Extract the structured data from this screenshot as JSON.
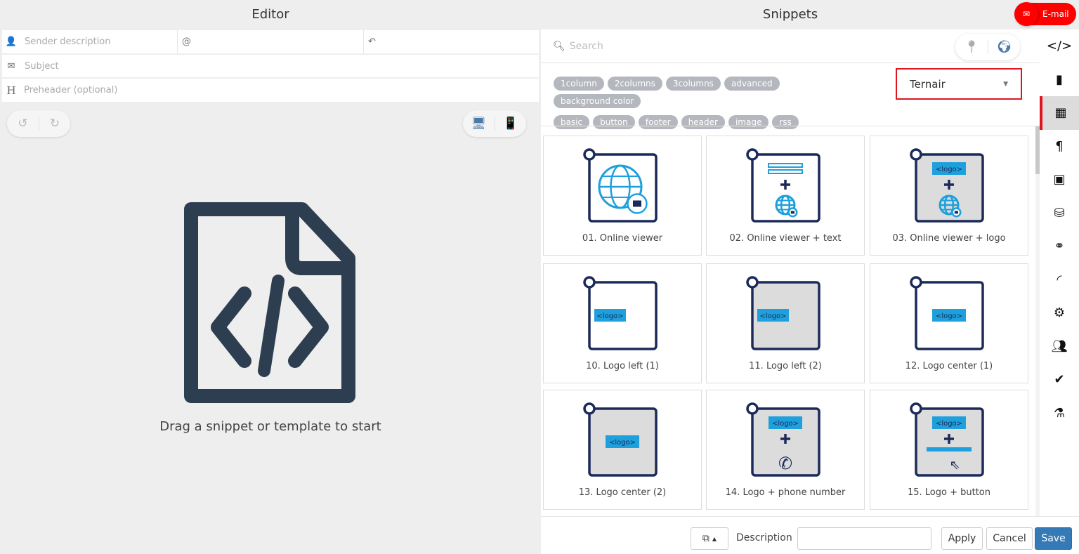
{
  "editor": {
    "title": "Editor",
    "sender_placeholder": "Sender description",
    "email_at": "@",
    "subject_placeholder": "Subject",
    "preheader_icon": "H",
    "preheader_placeholder": "Preheader (optional)",
    "empty_message": "Drag a snippet or template to start"
  },
  "snippets": {
    "title": "Snippets",
    "search_placeholder": "Search",
    "tags": [
      "1column",
      "2columns",
      "3columns",
      "advanced",
      "background color",
      "basic",
      "button",
      "footer",
      "header",
      "image",
      "rss"
    ],
    "select_value": "Ternair",
    "cards": [
      {
        "label": "01. Online viewer",
        "variant": "globe",
        "gray": false
      },
      {
        "label": "02. Online viewer + text",
        "variant": "text-globe",
        "gray": false
      },
      {
        "label": "03. Online viewer + logo",
        "variant": "logo-globe",
        "gray": true
      },
      {
        "label": "10. Logo left (1)",
        "variant": "logo-left",
        "gray": false
      },
      {
        "label": "11. Logo left (2)",
        "variant": "logo-left",
        "gray": true
      },
      {
        "label": "12. Logo center (1)",
        "variant": "logo-center",
        "gray": false
      },
      {
        "label": "13. Logo center (2)",
        "variant": "logo-center",
        "gray": true
      },
      {
        "label": "14. Logo + phone number",
        "variant": "logo-phone",
        "gray": true
      },
      {
        "label": "15. Logo + button",
        "variant": "logo-button",
        "gray": true
      }
    ],
    "logo_text": "<logo>"
  },
  "footer": {
    "description_label": "Description",
    "description_value": "",
    "apply": "Apply",
    "cancel": "Cancel",
    "save": "Save"
  },
  "email_button": "E-mail",
  "colors": {
    "accent_red": "#e0141e",
    "navy": "#1c2a5a",
    "cyan": "#1ea0dc",
    "save_blue": "#337ab7",
    "globe_blue": "#2a8de9"
  }
}
